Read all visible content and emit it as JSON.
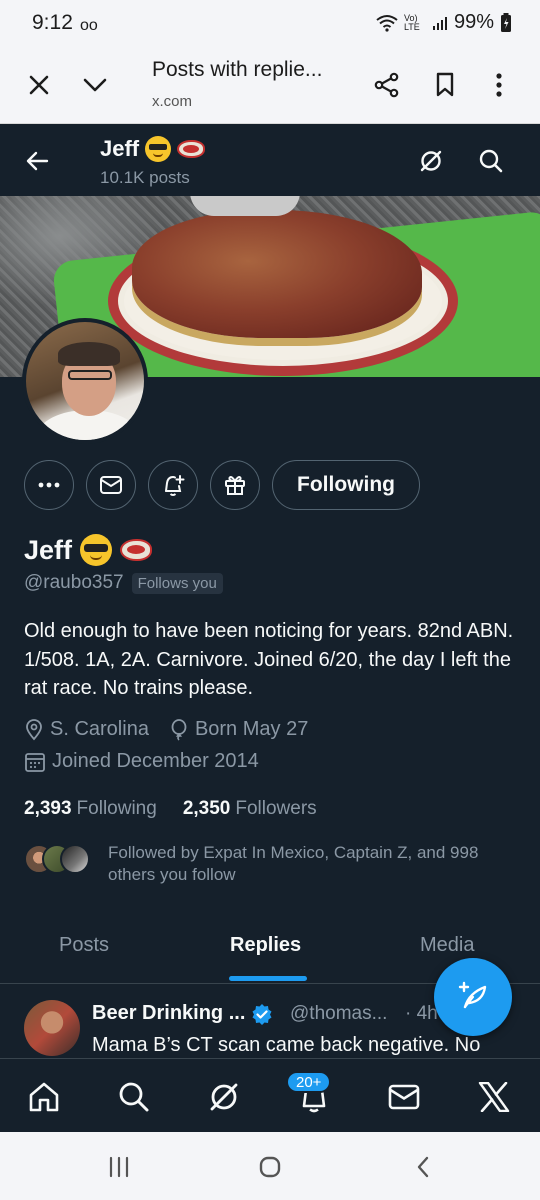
{
  "status_bar": {
    "time": "9:12",
    "voicemail_icon": "voicemail-icon",
    "network_label": "Vo) LTE",
    "battery": "99%"
  },
  "browser": {
    "title": "Posts with replie...",
    "domain": "x.com",
    "icons": [
      "close-icon",
      "chevron-down-icon",
      "share-icon",
      "bookmark-icon",
      "more-vertical-icon"
    ]
  },
  "header": {
    "name": "Jeff",
    "posts_count": "10.1K posts",
    "icons": [
      "back-arrow-icon",
      "grok-icon",
      "search-icon"
    ]
  },
  "profile": {
    "display_name": "Jeff",
    "emojis": [
      "sunglasses-emoji",
      "steak-emoji"
    ],
    "handle": "@raubo357",
    "follows_you": "Follows you",
    "bio": "Old enough to have been noticing for years.  82nd ABN.  1/508.  1A, 2A.  Carnivore.  Joined 6/20, the day I left the rat race. No trains please.",
    "location": "S. Carolina",
    "birthday": "Born May 27",
    "joined": "Joined December 2014",
    "following_count": "2,393",
    "following_label": "Following",
    "followers_count": "2,350",
    "followers_label": "Followers",
    "followed_by": "Followed by Expat In Mexico, Captain Z, and 998 others you follow"
  },
  "actions": {
    "follow_button": "Following",
    "icons": [
      "more-horizontal-icon",
      "message-icon",
      "notification-add-icon",
      "gift-icon"
    ]
  },
  "tabs": [
    {
      "label": "Posts",
      "active": false
    },
    {
      "label": "Replies",
      "active": true
    },
    {
      "label": "Media",
      "active": false
    }
  ],
  "tweet": {
    "author": "Beer Drinking ...",
    "handle": "@thomas...",
    "time": "· 4h",
    "text": "Mama B’s CT scan came back negative. No"
  },
  "bottom_nav": {
    "items": [
      "home-icon",
      "search-icon",
      "grok-icon",
      "notifications-icon",
      "messages-icon",
      "x-logo-icon"
    ],
    "notification_badge": "20+"
  },
  "colors": {
    "background": "#15202b",
    "accent": "#1d9bf0",
    "muted_text": "#8b98a5",
    "border": "#536471"
  }
}
